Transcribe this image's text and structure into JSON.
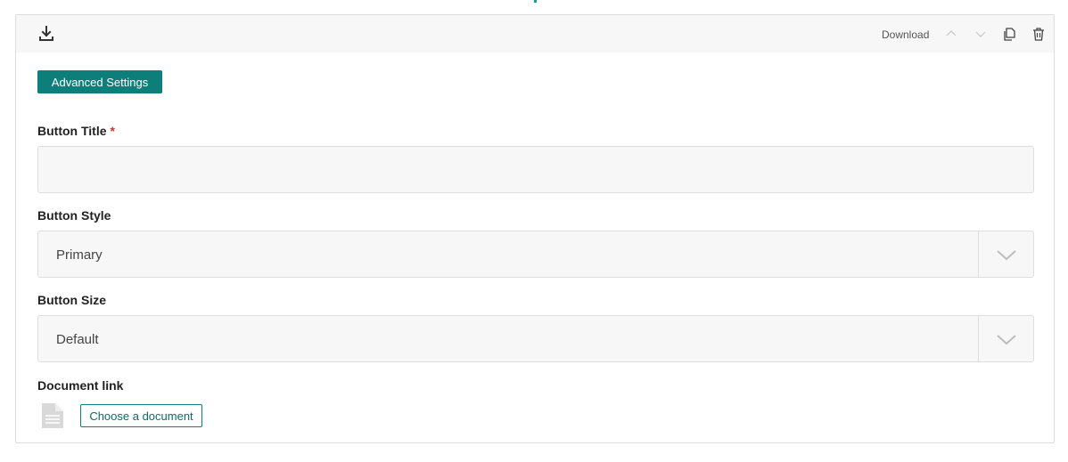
{
  "block": {
    "type_icon": "download-icon",
    "label": "Download",
    "actions": {
      "move_up_icon": "chevron-up-icon",
      "move_down_icon": "chevron-down-icon",
      "duplicate_icon": "copy-icon",
      "delete_icon": "trash-icon"
    }
  },
  "advanced_settings_label": "Advanced Settings",
  "fields": {
    "button_title": {
      "label": "Button Title",
      "required_marker": "*",
      "value": "",
      "placeholder": ""
    },
    "button_style": {
      "label": "Button Style",
      "selected": "Primary"
    },
    "button_size": {
      "label": "Button Size",
      "selected": "Default"
    },
    "document_link": {
      "label": "Document link",
      "icon": "document-icon",
      "button_label": "Choose a document"
    }
  },
  "colors": {
    "accent": "#0e7e7a",
    "required": "#c0392b",
    "field_bg": "#f7f7f7"
  }
}
